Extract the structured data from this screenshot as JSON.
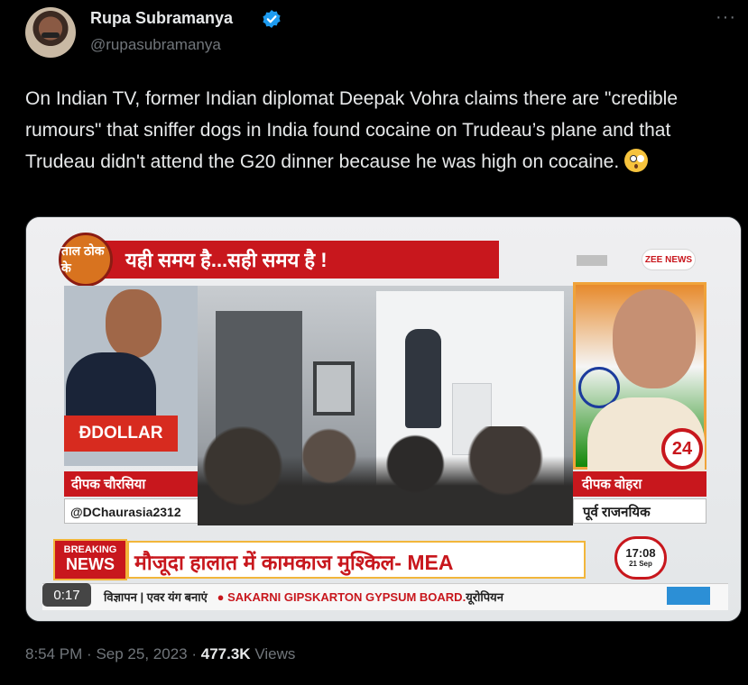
{
  "author": {
    "name": "Rupa Subramanya",
    "handle": "@rupasubramanya",
    "verified": true
  },
  "menu": {
    "more_label": "···"
  },
  "tweet": {
    "text": "On Indian TV, former Indian diplomat Deepak Vohra claims there are \"credible rumours\" that sniffer dogs in India found cocaine on Trudeau’s plane and that Trudeau didn't attend the G20 dinner because he was high on cocaine.",
    "emoji": "flushed-face-emoji"
  },
  "video": {
    "duration": "0:17",
    "headline_top": "यही समय है...सही समय है !",
    "show_logo_text": "ताल ठोक के",
    "channel": "ZEE NEWS",
    "host": {
      "brand": "DOLLAR",
      "name": "दीपक चौरसिया",
      "handle": "@DChaurasia2312"
    },
    "guest": {
      "name": "दीपक वोहरा",
      "title": "पूर्व राजनयिक",
      "channel_number": "24"
    },
    "breaking": {
      "label_top": "BREAKING",
      "label_bottom": "NEWS",
      "text": "मौजूदा हालात में कामकाज मुश्किल- MEA"
    },
    "clock": {
      "time": "17:08",
      "date": "21 Sep"
    },
    "ticker": {
      "left": "विज्ञापन | एवर यंग बनाएं",
      "main": "● SAKARNI GIPSKARTON GYPSUM BOARD.",
      "right": "यूरोपियन"
    }
  },
  "footer": {
    "time": "8:54 PM",
    "separator": "·",
    "date": "Sep 25, 2023",
    "views_count": "477.3K",
    "views_label": "Views"
  },
  "colors": {
    "background": "#000000",
    "verified_blue": "#1d9bf0",
    "news_red": "#c8171d"
  }
}
